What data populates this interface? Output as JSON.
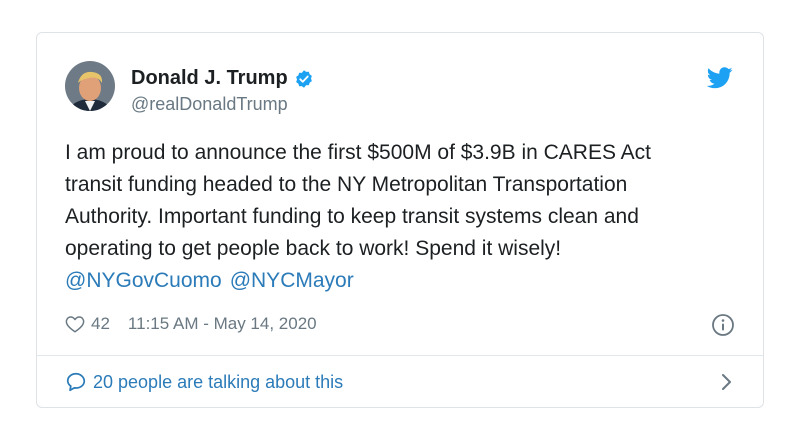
{
  "author": {
    "name": "Donald J. Trump",
    "handle": "@realDonaldTrump",
    "verified": true,
    "avatar_icon": "profile-photo"
  },
  "tweet": {
    "lines": [
      "I am proud to announce the first $500M of $3.9B in CARES Act",
      "transit funding headed to the NY Metropolitan Transportation",
      "Authority. Important funding to keep transit systems clean and",
      "operating to get people back to work! Spend it wisely!"
    ],
    "mentions": [
      "@NYGovCuomo",
      "@NYCMayor"
    ]
  },
  "meta": {
    "likes": "42",
    "timestamp": "11:15 AM - May 14, 2020"
  },
  "footer": {
    "talking_text": "20 people are talking about this"
  },
  "colors": {
    "link": "#2b7bb9",
    "twitter_blue": "#1da1f2",
    "muted": "#697882",
    "border": "#dfe3e6"
  }
}
